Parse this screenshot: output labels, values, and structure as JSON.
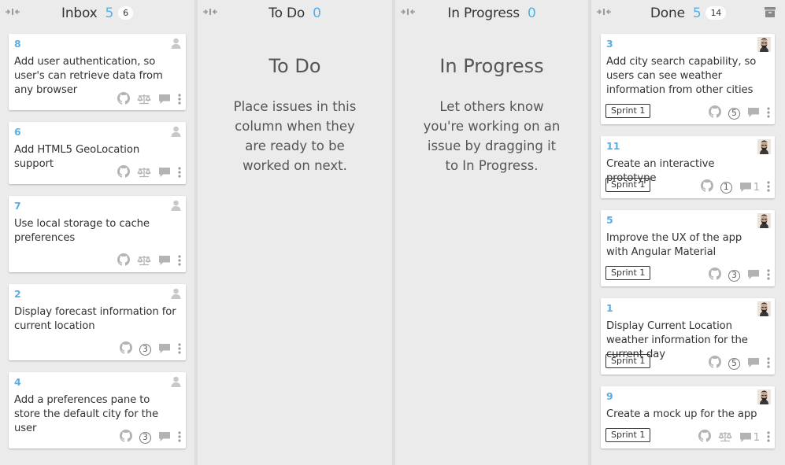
{
  "columns": {
    "inbox": {
      "title": "Inbox",
      "count": "5",
      "badge": "6"
    },
    "todo": {
      "title": "To Do",
      "count": "0",
      "empty_title": "To Do",
      "empty_text": "Place issues in this column when they are ready to be worked on next."
    },
    "inprogress": {
      "title": "In Progress",
      "count": "0",
      "empty_title": "In Progress",
      "empty_text": "Let others know you're working on an issue by dragging it to In Progress."
    },
    "done": {
      "title": "Done",
      "count": "5",
      "badge": "14"
    }
  },
  "inbox_cards": [
    {
      "number": "8",
      "title": "Add user authentication, so user's can retrieve data from any browser",
      "icons": [
        "github-icon",
        "scale-icon",
        "comment-icon",
        "kebab-icon"
      ]
    },
    {
      "number": "6",
      "title": "Add HTML5 GeoLocation support",
      "icons": [
        "github-icon",
        "scale-icon",
        "comment-icon",
        "kebab-icon"
      ]
    },
    {
      "number": "7",
      "title": "Use local storage to cache preferences",
      "icons": [
        "github-icon",
        "scale-icon",
        "comment-icon",
        "kebab-icon"
      ]
    },
    {
      "number": "2",
      "title": "Display forecast information for current location",
      "estimate": "3"
    },
    {
      "number": "4",
      "title": "Add a preferences pane to store the default city for the user",
      "estimate": "3"
    }
  ],
  "done_cards": [
    {
      "number": "3",
      "title": "Add city search capability, so users can see weather information from other cities",
      "sprint": "Sprint 1",
      "estimate": "5"
    },
    {
      "number": "11",
      "title": "Create an interactive prototype",
      "sprint": "Sprint 1",
      "estimate": "1",
      "comments": "1"
    },
    {
      "number": "5",
      "title": "Improve the UX of the app with Angular Material",
      "sprint": "Sprint 1",
      "estimate": "3"
    },
    {
      "number": "1",
      "title": "Display Current Location weather information for the current day",
      "sprint": "Sprint 1",
      "estimate": "5"
    },
    {
      "number": "9",
      "title": "Create a mock up for the app",
      "sprint": "Sprint 1",
      "comments": "1"
    }
  ],
  "colors": {
    "accent": "#58aee5",
    "column_bg": "#ebebeb",
    "gutter": "#dedede",
    "icon": "#b3b3b3"
  }
}
